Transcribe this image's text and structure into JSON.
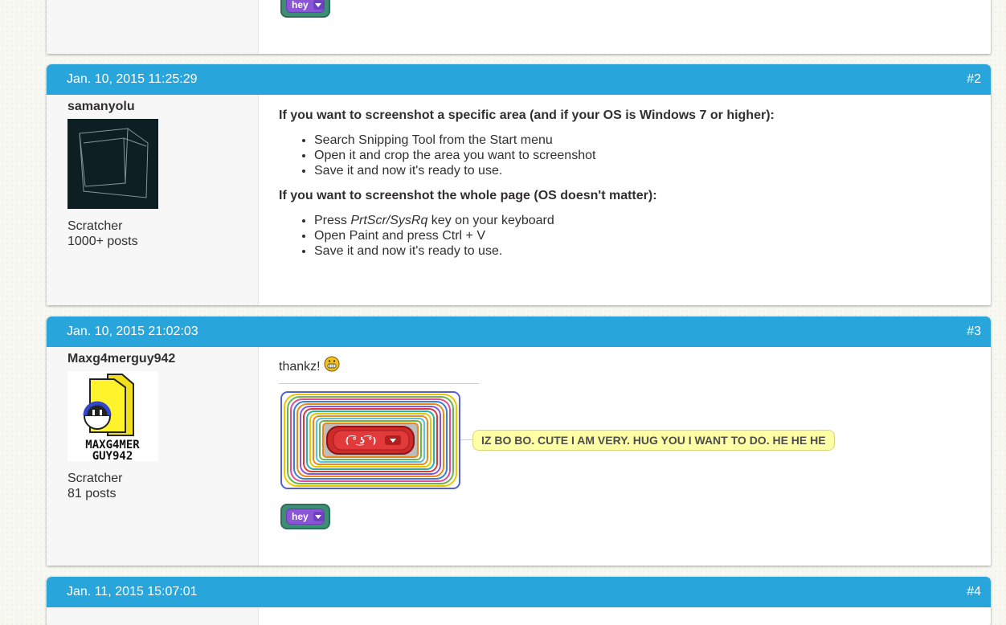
{
  "prev_post": {
    "block_label": "hey"
  },
  "posts": [
    {
      "timestamp": "Jan. 10, 2015 11:25:29",
      "number": "#2",
      "username": "samanyolu",
      "rank": "Scratcher",
      "post_count": "1000+ posts",
      "heading1": "If you want to screenshot a specific area (and if your OS is Windows 7 or higher):",
      "list1": [
        "Search Snipping Tool from the Start menu",
        "Open it and crop the area you want to screenshot",
        "Save it and now it's ready to use."
      ],
      "heading2": "If you want to screenshot the whole page (OS doesn't matter):",
      "list2_item1_prefix": "Press ",
      "list2_item1_em": "PrtScr/SysRq",
      "list2_item1_suffix": " key on your keyboard",
      "list2_item2": "Open Paint and press Ctrl + V",
      "list2_item3": "Save it and now it's ready to use."
    },
    {
      "timestamp": "Jan. 10, 2015 21:02:03",
      "number": "#3",
      "username": "Maxg4merguy942",
      "rank": "Scratcher",
      "post_count": "81 posts",
      "text": "thankz!",
      "avatar_text": "MAXG4MER\nGUY942",
      "block_face": "( ͡° ͜ʖ ͡°)",
      "tooltip": "IZ BO BO. CUTE I AM VERY. HUG YOU I WANT TO DO. HE HE HE",
      "block_label": "hey"
    },
    {
      "timestamp": "Jan. 11, 2015 15:07:01",
      "number": "#4"
    }
  ],
  "colors": {
    "header": "#28a5da",
    "block_green": "#3c8f74",
    "block_purple": "#8a55d7",
    "tooltip": "#ffffa5"
  }
}
